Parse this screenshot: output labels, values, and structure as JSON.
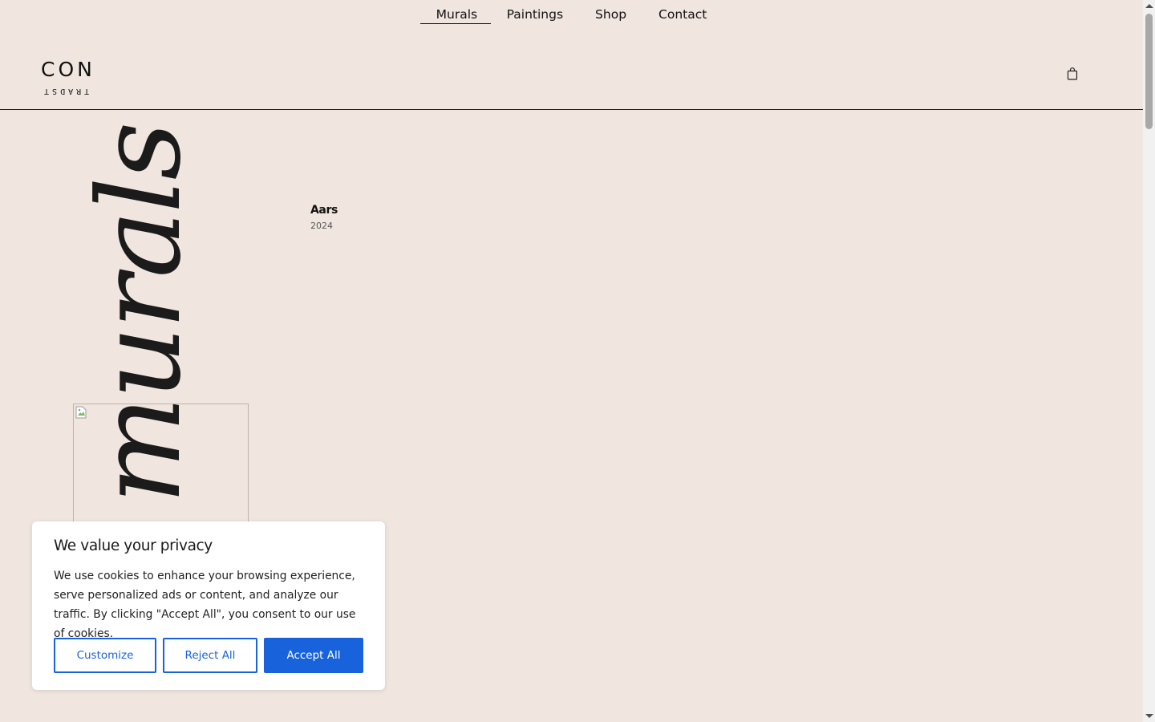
{
  "nav": {
    "items": [
      {
        "label": "Murals",
        "active": true
      },
      {
        "label": "Paintings",
        "active": false
      },
      {
        "label": "Shop",
        "active": false
      },
      {
        "label": "Contact",
        "active": false
      }
    ]
  },
  "header": {
    "logo_top": "CON",
    "logo_bottom": "TRADST",
    "cart_icon": "shopping-bag-icon"
  },
  "main": {
    "vertical_title": "murals",
    "image_icon": "broken-image-icon",
    "project": {
      "name": "Aars",
      "year": "2024"
    }
  },
  "cookie": {
    "title": "We value your privacy",
    "text": "We use cookies to enhance your browsing experience, serve personalized ads or content, and analyze our traffic. By clicking \"Accept All\", you consent to our use of cookies.",
    "customize_label": "Customize",
    "reject_label": "Reject All",
    "accept_label": "Accept All"
  },
  "colors": {
    "background": "#f0e6df",
    "accent": "#1863dc"
  }
}
